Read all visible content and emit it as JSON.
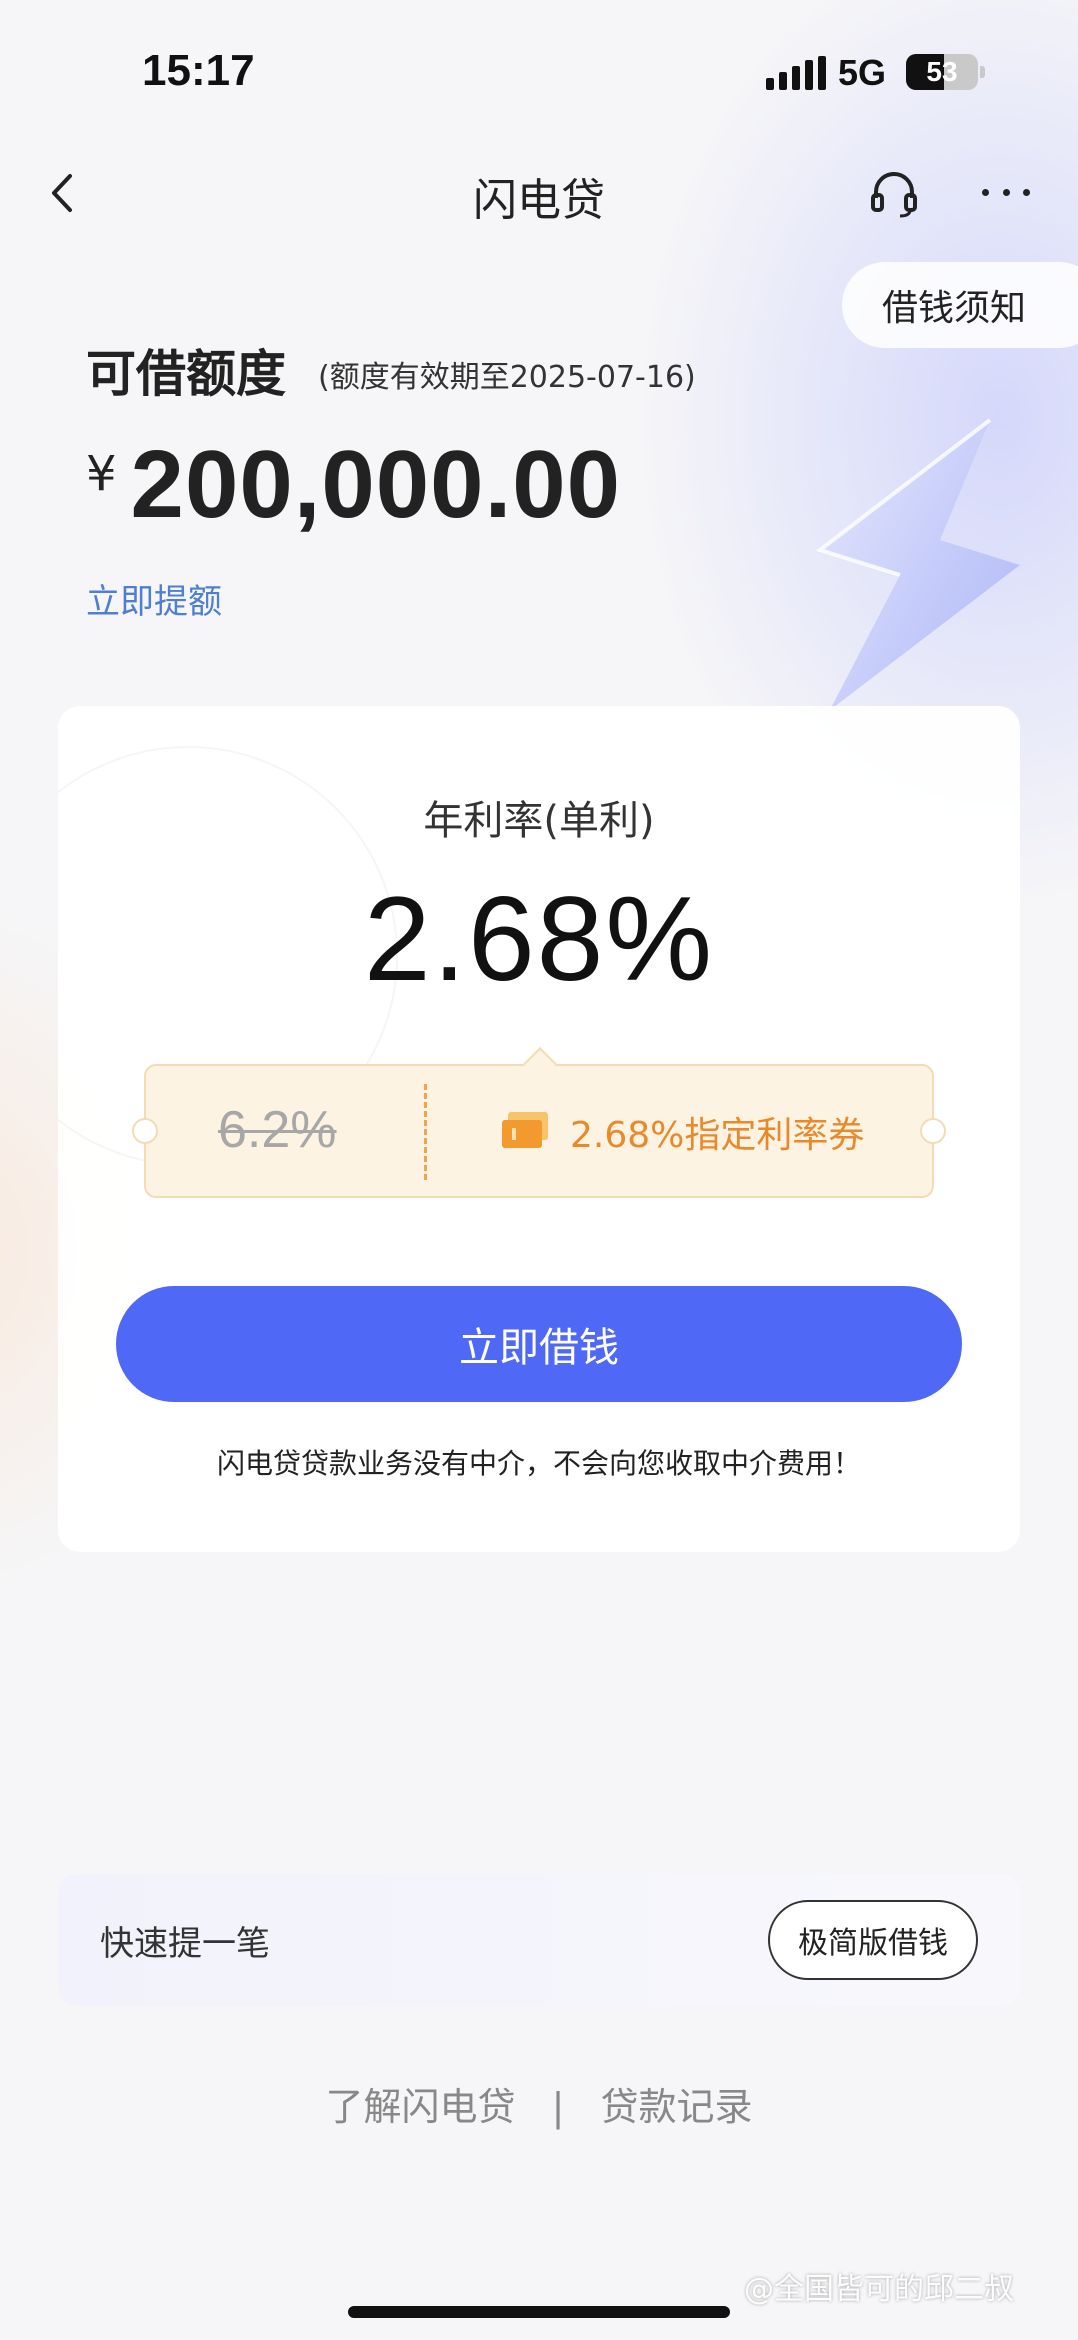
{
  "status_bar": {
    "time": "15:17",
    "network": "5G",
    "battery": "53",
    "battery_level": 0.53
  },
  "nav": {
    "title": "闪电贷",
    "icons": [
      "back-icon",
      "headset-icon",
      "more-icon"
    ]
  },
  "notice_button": "借钱须知",
  "credit": {
    "title": "可借额度",
    "validity": "(额度有效期至2025-07-16)",
    "currency": "¥",
    "amount": "200,000.00",
    "raise_link": "立即提额"
  },
  "rate_card": {
    "label": "年利率(单利)",
    "value": "2.68%",
    "original_rate": "6.2%",
    "coupon_text": "2.68%指定利率券",
    "borrow_button": "立即借钱",
    "disclaimer": "闪电贷贷款业务没有中介，不会向您收取中介费用！"
  },
  "quick": {
    "label": "快速提一笔",
    "button": "极简版借钱"
  },
  "footer": {
    "link_about": "了解闪电贷",
    "separator": "|",
    "link_records": "贷款记录"
  },
  "watermark": "@全国皆可的邱二叔",
  "colors": {
    "primary": "#4f68f5",
    "link": "#4f7fd0",
    "coupon": "#e88a2c"
  }
}
